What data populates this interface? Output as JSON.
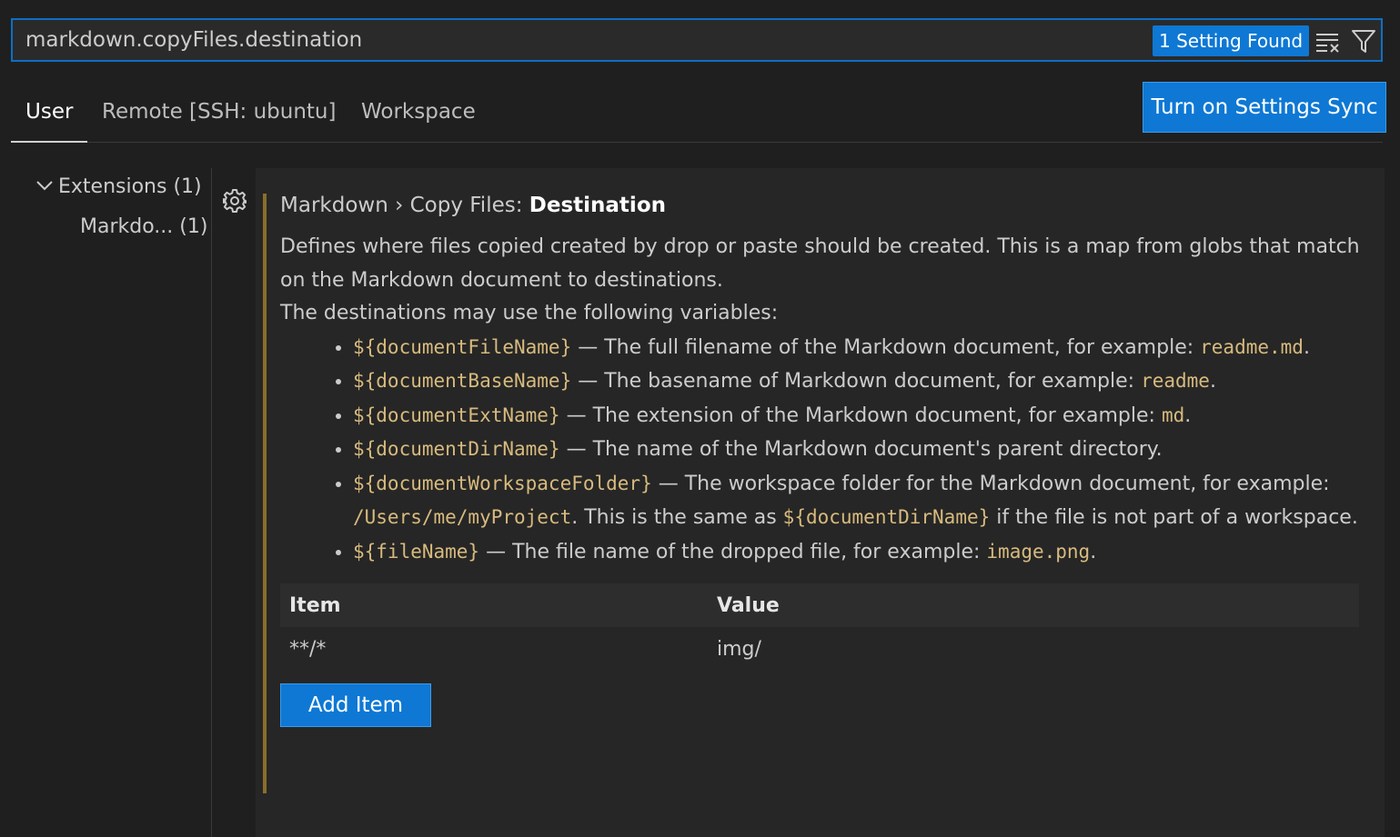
{
  "search": {
    "value": "markdown.copyFiles.destination",
    "results_badge": "1 Setting Found"
  },
  "tabs": [
    {
      "label": "User",
      "active": true
    },
    {
      "label": "Remote [SSH: ubuntu]",
      "active": false
    },
    {
      "label": "Workspace",
      "active": false
    }
  ],
  "sync_button_label": "Turn on Settings Sync",
  "toc": {
    "extensions_label": "Extensions (1)",
    "markdown_label": "Markdo... (1)"
  },
  "setting": {
    "breadcrumb": "Markdown › Copy Files: ",
    "name": "Destination",
    "desc_1": "Defines where files copied created by drop or paste should be created. This is a map from globs that match on the Markdown document to destinations.",
    "desc_2": "The destinations may use the following variables:",
    "variables": [
      {
        "code": "${documentFileName}",
        "text": " — The full filename of the Markdown document, for example: ",
        "example": "readme.md",
        "tail": "."
      },
      {
        "code": "${documentBaseName}",
        "text": " — The basename of Markdown document, for example: ",
        "example": "readme",
        "tail": "."
      },
      {
        "code": "${documentExtName}",
        "text": " — The extension of the Markdown document, for example: ",
        "example": "md",
        "tail": "."
      },
      {
        "code": "${documentDirName}",
        "text": " — The name of the Markdown document's parent directory.",
        "example": "",
        "tail": ""
      },
      {
        "code": "${documentWorkspaceFolder}",
        "text": " — The workspace folder for the Markdown document, for example: ",
        "example": "/Users/me/myProject",
        "tail": ". This is the same as ",
        "code2": "${documentDirName}",
        "tail2": " if the file is not part of a workspace."
      },
      {
        "code": "${fileName}",
        "text": " — The file name of the dropped file, for example: ",
        "example": "image.png",
        "tail": "."
      }
    ],
    "table": {
      "headers": {
        "item": "Item",
        "value": "Value"
      },
      "rows": [
        {
          "item": "**/*",
          "value": "img/"
        }
      ]
    },
    "add_item_label": "Add Item"
  },
  "icons": {
    "clear": "clear-filter-icon",
    "filter": "filter-icon",
    "gear": "gear-icon",
    "chevron": "chevron-down-icon"
  },
  "colors": {
    "accent": "#0e78d4",
    "code": "#d7ba7d",
    "modified_bar": "#8a6d2b"
  }
}
